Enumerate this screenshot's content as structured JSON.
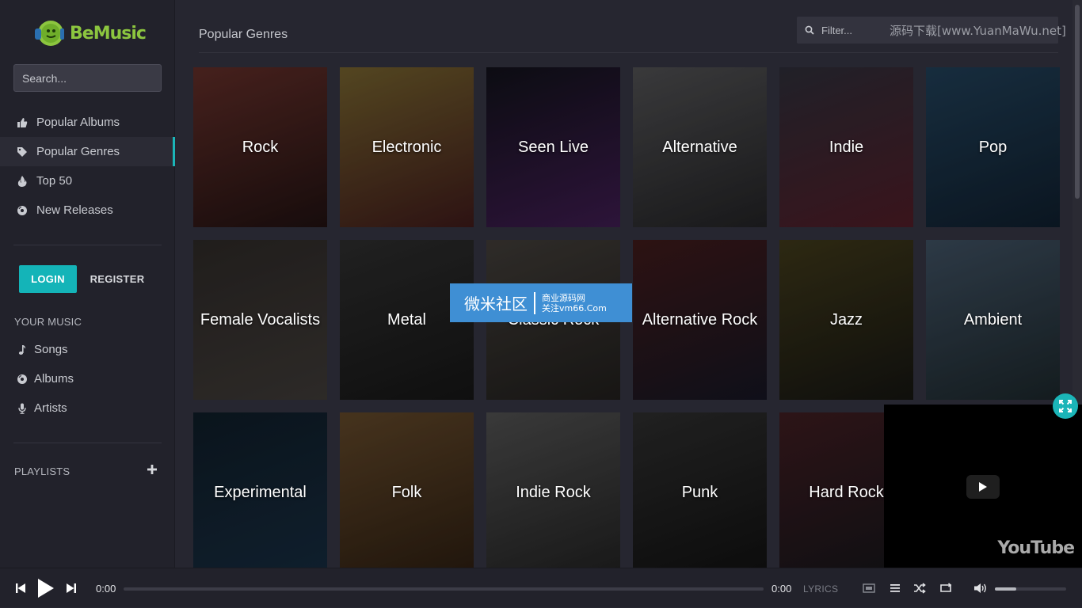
{
  "app": {
    "brand": "BeMusic"
  },
  "sidebar": {
    "search_placeholder": "Search...",
    "nav": [
      {
        "label": "Popular Albums",
        "icon": "thumbs-up-icon"
      },
      {
        "label": "Popular Genres",
        "icon": "tags-icon",
        "active": true
      },
      {
        "label": "Top 50",
        "icon": "fire-icon"
      },
      {
        "label": "New Releases",
        "icon": "disc-icon"
      }
    ],
    "login_label": "LOGIN",
    "register_label": "REGISTER",
    "your_music_label": "YOUR MUSIC",
    "your_music": [
      {
        "label": "Songs",
        "icon": "music-note-icon"
      },
      {
        "label": "Albums",
        "icon": "disc-icon"
      },
      {
        "label": "Artists",
        "icon": "microphone-icon"
      }
    ],
    "playlists_label": "PLAYLISTS"
  },
  "main": {
    "title": "Popular Genres",
    "filter_placeholder": "Filter...",
    "watermark": "源码下载[www.YuanMaWu.net]",
    "genres": [
      {
        "label": "Rock",
        "bg": [
          "#5a2a25",
          "#1e1010"
        ]
      },
      {
        "label": "Electronic",
        "bg": [
          "#6b5a2a",
          "#3a1818"
        ]
      },
      {
        "label": "Seen Live",
        "bg": [
          "#101018",
          "#3a1a4a"
        ]
      },
      {
        "label": "Alternative",
        "bg": [
          "#4a4a4c",
          "#202022"
        ]
      },
      {
        "label": "Indie",
        "bg": [
          "#2a2a34",
          "#4a1a24"
        ]
      },
      {
        "label": "Pop",
        "bg": [
          "#1e3a50",
          "#0e1c2a"
        ]
      },
      {
        "label": "Female Vocalists",
        "bg": [
          "#2a2624",
          "#3a3633"
        ]
      },
      {
        "label": "Metal",
        "bg": [
          "#2a2a2a",
          "#141414"
        ]
      },
      {
        "label": "Classic Rock",
        "bg": [
          "#3c3834",
          "#1e1c1a"
        ]
      },
      {
        "label": "Alternative Rock",
        "bg": [
          "#3a1818",
          "#141420"
        ]
      },
      {
        "label": "Jazz",
        "bg": [
          "#3a3418",
          "#141410"
        ]
      },
      {
        "label": "Ambient",
        "bg": [
          "#3a4a5a",
          "#1a2428"
        ]
      },
      {
        "label": "Experimental",
        "bg": [
          "#0e1a24",
          "#14283a"
        ]
      },
      {
        "label": "Folk",
        "bg": [
          "#5a4226",
          "#2a1c10"
        ]
      },
      {
        "label": "Indie Rock",
        "bg": [
          "#4a4a4a",
          "#202020"
        ]
      },
      {
        "label": "Punk",
        "bg": [
          "#2a2a2a",
          "#101010"
        ]
      },
      {
        "label": "Hard Rock",
        "bg": [
          "#3a1a1e",
          "#141418"
        ]
      }
    ]
  },
  "overlay": {
    "badge_big": "微米社区",
    "badge_small_1": "商业源码网",
    "badge_small_2": "关注vm66.Com",
    "youtube_logo": "YouTube"
  },
  "player": {
    "current_time": "0:00",
    "total_time": "0:00",
    "lyrics_label": "LYRICS",
    "progress": 0,
    "volume": 0.3
  },
  "colors": {
    "accent": "#14b4b8",
    "brand_green": "#8cc63f"
  }
}
